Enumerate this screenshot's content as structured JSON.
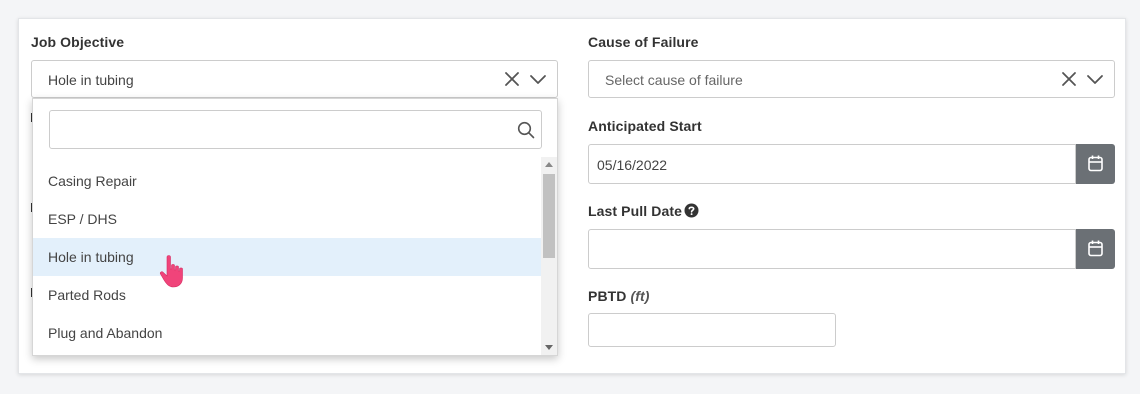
{
  "job_objective": {
    "label": "Job Objective",
    "value": "Hole in tubing",
    "search_placeholder": "",
    "options": [
      "Casing Repair",
      "ESP / DHS",
      "Hole in tubing",
      "Parted Rods",
      "Plug and Abandon"
    ],
    "highlighted_option": "Hole in tubing"
  },
  "cause_of_failure": {
    "label": "Cause of Failure",
    "placeholder": "Select cause of failure"
  },
  "anticipated_start": {
    "label": "Anticipated Start",
    "value": "05/16/2022"
  },
  "last_pull_date": {
    "label": "Last Pull Date",
    "value": ""
  },
  "pbtd": {
    "label": "PBTD",
    "unit": "(ft)",
    "value": ""
  },
  "colors": {
    "highlight": "#e3f0fb",
    "calendar_button": "#6b7075",
    "cursor": "#f0447a"
  },
  "icons": {
    "clear": "close-icon",
    "expand": "chevron-down-icon",
    "search": "search-icon",
    "calendar": "calendar-icon",
    "help": "question-circle-icon",
    "pointer": "hand-pointer-icon"
  }
}
